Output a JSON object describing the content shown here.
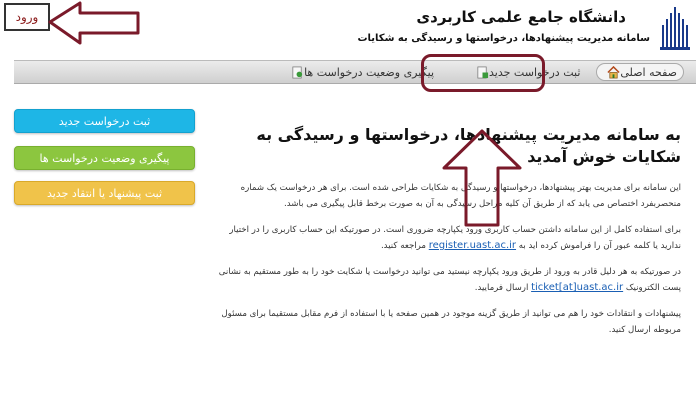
{
  "header": {
    "university_name": "دانشگاه جامع علمی کاربردی",
    "system_name": "سامانه مدیریت پیشنهادها، درخواستها و رسیدگی به شکایات",
    "login_label": "ورود"
  },
  "nav": {
    "home_label": "صفحه اصلی",
    "submit_request_label": "ثبت درخواست جدید",
    "track_request_label": "پیگیری وضعیت درخواست ها"
  },
  "side_buttons": {
    "submit_request": "ثبت درخواست جدید",
    "track_request": "پیگیری وضعیت درخواست ها",
    "submit_suggestion": "ثبت پیشنهاد یا انتقاد جدید"
  },
  "main": {
    "welcome_title": "به سامانه مدیریت پیشنهادها، درخواستها و رسیدگی به شکایات خوش آمدید",
    "para1": "این سامانه برای مدیریت بهتر پیشنهادها، درخواستها و رسیدگی به شکایات طراحی شده است. برای هر درخواست یک شماره منحصربفرد اختصاص می یابد که از طریق آن کلیه مراحل رسیدگی به آن به صورت برخط قابل پیگیری می باشد.",
    "para2_before": "برای استفاده کامل از این سامانه داشتن حساب کاربری ورود یکپارچه ضروری است. در صورتیکه این حساب کاربری را در اختیار ندارید یا کلمه عبور آن را فراموش کرده اید به ",
    "para2_link": "register.uast.ac.ir",
    "para2_after": " مراجعه کنید.",
    "para3_before": "در صورتیکه به هر دلیل قادر به ورود از طریق ورود یکپارچه نیستید می توانید درخواست یا شکایت خود را به طور مستقیم به نشانی پست الکترونیک ",
    "para3_link": "ticket[at]uast.ac.ir",
    "para3_after": " ارسال فرمایید.",
    "para4": "پیشنهادات و انتقادات خود را هم می توانید از طریق گزینه موجود در همین صفحه یا با استفاده از فرم مقابل مستقیما برای مسئول مربوطه ارسال کنید."
  },
  "colors": {
    "annotation": "#7a1a2a",
    "btn_blue": "#1eb6e6",
    "btn_green": "#8cc63f",
    "btn_orange": "#f0c34a",
    "link": "#1a5fb4"
  }
}
